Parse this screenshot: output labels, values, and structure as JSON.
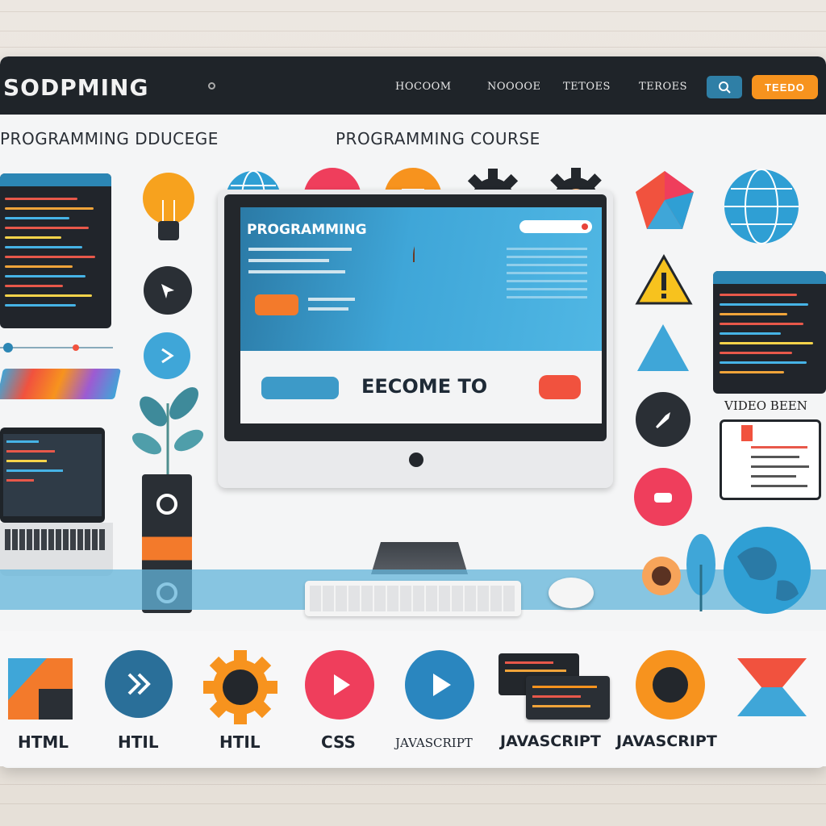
{
  "header": {
    "brand": "SODPMING",
    "nav": [
      "HOCOOM",
      "NOOOOE",
      "TETOES",
      "TEROES"
    ],
    "search_icon": "search-icon",
    "cta_label": "TEEDO"
  },
  "headings": {
    "left": "PROGRAMMING  DDUCEGE",
    "center": "PROGRAMMING  COURSE"
  },
  "screen": {
    "title": "PROGRAMMING",
    "welcome": "EECOME TO"
  },
  "side_label": "VIDEO  BEEN",
  "bottom_items": [
    {
      "label": "HTML",
      "icon": "html-shape-icon"
    },
    {
      "label": "HTIL",
      "icon": "forward-icon"
    },
    {
      "label": "HTIL",
      "icon": "gear-icon"
    },
    {
      "label": "CSS",
      "icon": "play-icon"
    },
    {
      "label": "JAVASCRIPT",
      "icon": "play-icon"
    },
    {
      "label": "JAVASCRIPT",
      "icon": "code-window-icon"
    },
    {
      "label": "JAVASCRIPT",
      "icon": "record-icon"
    }
  ],
  "colors": {
    "topbar": "#1f2429",
    "accent_blue": "#2c86b4",
    "accent_orange": "#f7931e",
    "accent_red": "#f1523e"
  }
}
